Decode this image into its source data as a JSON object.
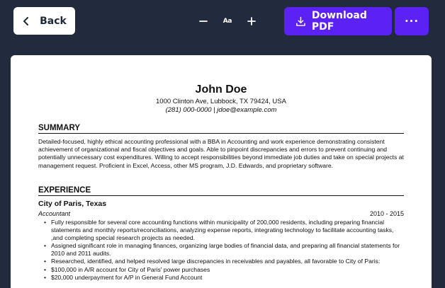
{
  "toolbar": {
    "back_label": "Back",
    "zoom_label": "Aa",
    "download_label": "Download PDF",
    "more_label": "···"
  },
  "resume": {
    "name": "John Doe",
    "address": "1000 Clinton Ave, Lubbock, TX 79424, USA",
    "contact": "(281) 000-0000 | jdoe@example.com",
    "summary_heading": "SUMMARY",
    "summary_text": "Detailed-focused, highly ethical accounting professional with a BBA in Accounting and work experience demonstrating consistent achievement of organizational and fiscal objectives and goals. Able to pinpoint discrepancies and errors to prevent continuing and potentially unnecessary cost expenditures. Willing to accept responsibilities beyond immediate job duties and take on special projects at management request. Proficient in Excel, Access, other MS program, J.D. Edwards, and proprietary software.",
    "experience_heading": "EXPERIENCE",
    "job": {
      "employer": "City of Paris, Texas",
      "role": "Accountant",
      "dates": "2010 - 2015",
      "bullets": [
        "Fully responsible for several core accounting functions within municipality of 200,000 residents, including preparing financial statements and monthly reports/reconciliations, analyzing expense reports, integrating technology to facilitate accounting tasks, ,and completing special research projects as needed.",
        "Assigned significant role in managing finances, organizing large bodies of financial data, and preparing all financial statements for 2010 and 2011 audits.",
        "Researched, identified, and helped resolved large discrepancies in receivables and payables, all favorable to City of Paris:",
        "$100,000 in A/R account for City of Paris' power purchases",
        "$20,000 underpayment for A/P in General Fund Account"
      ]
    }
  },
  "colors": {
    "topbar_bg": "#222a3d",
    "accent": "#5b21f5",
    "paper": "#ffffff"
  }
}
